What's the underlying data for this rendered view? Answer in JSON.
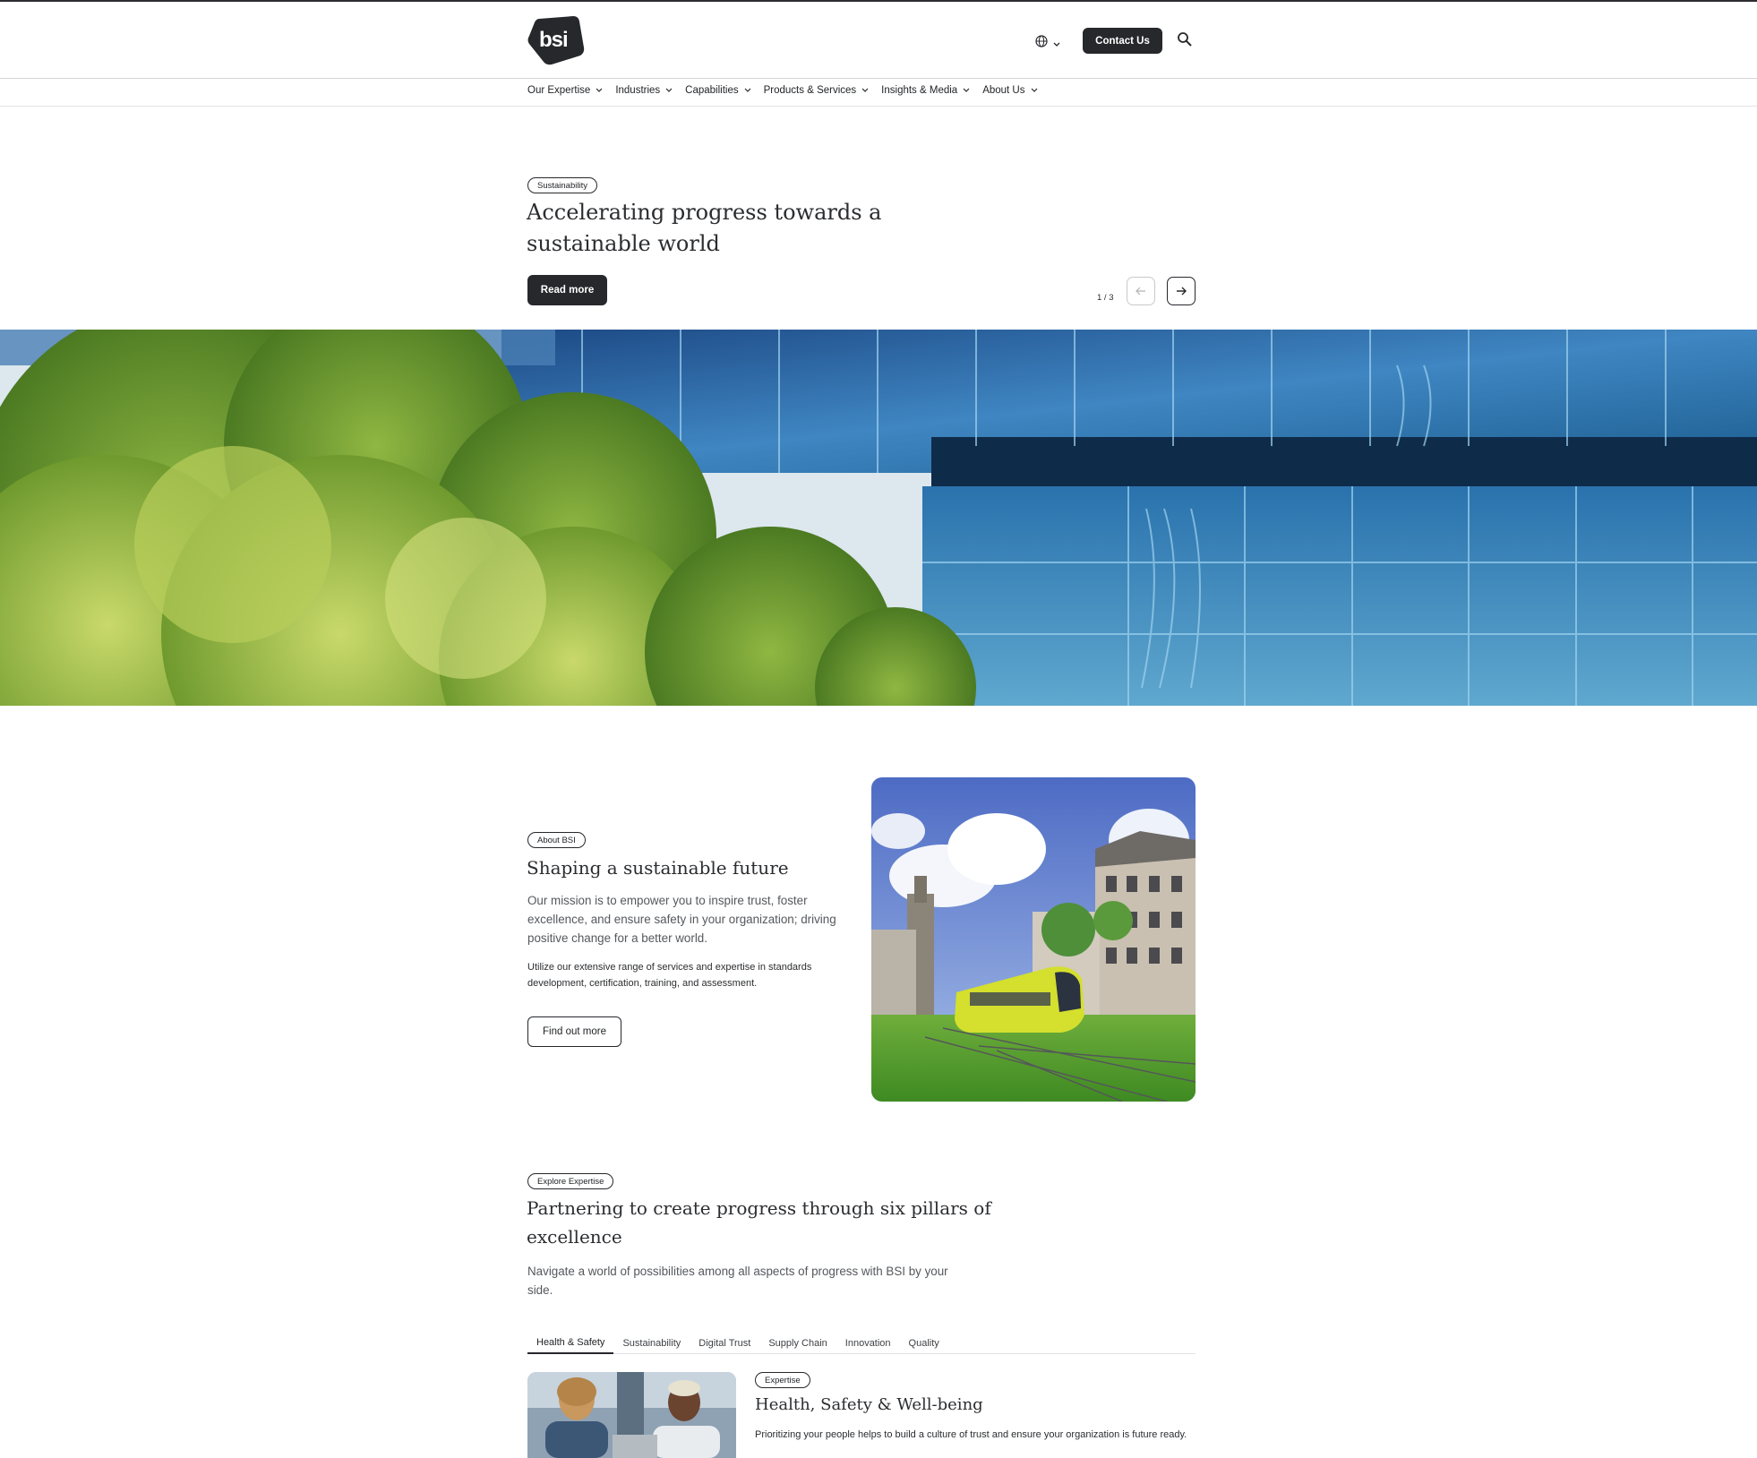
{
  "header": {
    "logo_text": "bsi",
    "contact_label": "Contact Us",
    "icons": {
      "language": "globe-icon",
      "search": "search-icon"
    }
  },
  "nav": {
    "items": [
      {
        "label": "Our Expertise"
      },
      {
        "label": "Industries"
      },
      {
        "label": "Capabilities"
      },
      {
        "label": "Products & Services"
      },
      {
        "label": "Insights & Media"
      },
      {
        "label": "About Us"
      }
    ]
  },
  "hero": {
    "tag": "Sustainability",
    "title": "Accelerating progress towards a sustainable world",
    "cta_label": "Read more",
    "pager": "1 / 3"
  },
  "about": {
    "tag": "About BSI",
    "title": "Shaping a sustainable future",
    "paragraph": "Our mission is to empower you to inspire trust, foster excellence, and ensure safety in your organization; driving positive change for a better world.",
    "subparagraph": "Utilize our extensive range of services and expertise in standards development, certification, training, and assessment.",
    "cta_label": "Find out more"
  },
  "explore": {
    "tag": "Explore Expertise",
    "title": "Partnering to create progress through six pillars of excellence",
    "paragraph": "Navigate a world of possibilities among all aspects of progress with BSI by your side.",
    "tabs": [
      {
        "label": "Health & Safety"
      },
      {
        "label": "Sustainability"
      },
      {
        "label": "Digital Trust"
      },
      {
        "label": "Supply Chain"
      },
      {
        "label": "Innovation"
      },
      {
        "label": "Quality"
      }
    ],
    "active_tab": "Health & Safety",
    "card": {
      "tag": "Expertise",
      "title": "Health, Safety & Well-being",
      "description": "Prioritizing your people helps to build a culture of trust and ensure your organization is future ready."
    }
  },
  "colors": {
    "primary_dark": "#26282c",
    "text_muted": "#55585c",
    "divider": "#e1e3e6"
  }
}
